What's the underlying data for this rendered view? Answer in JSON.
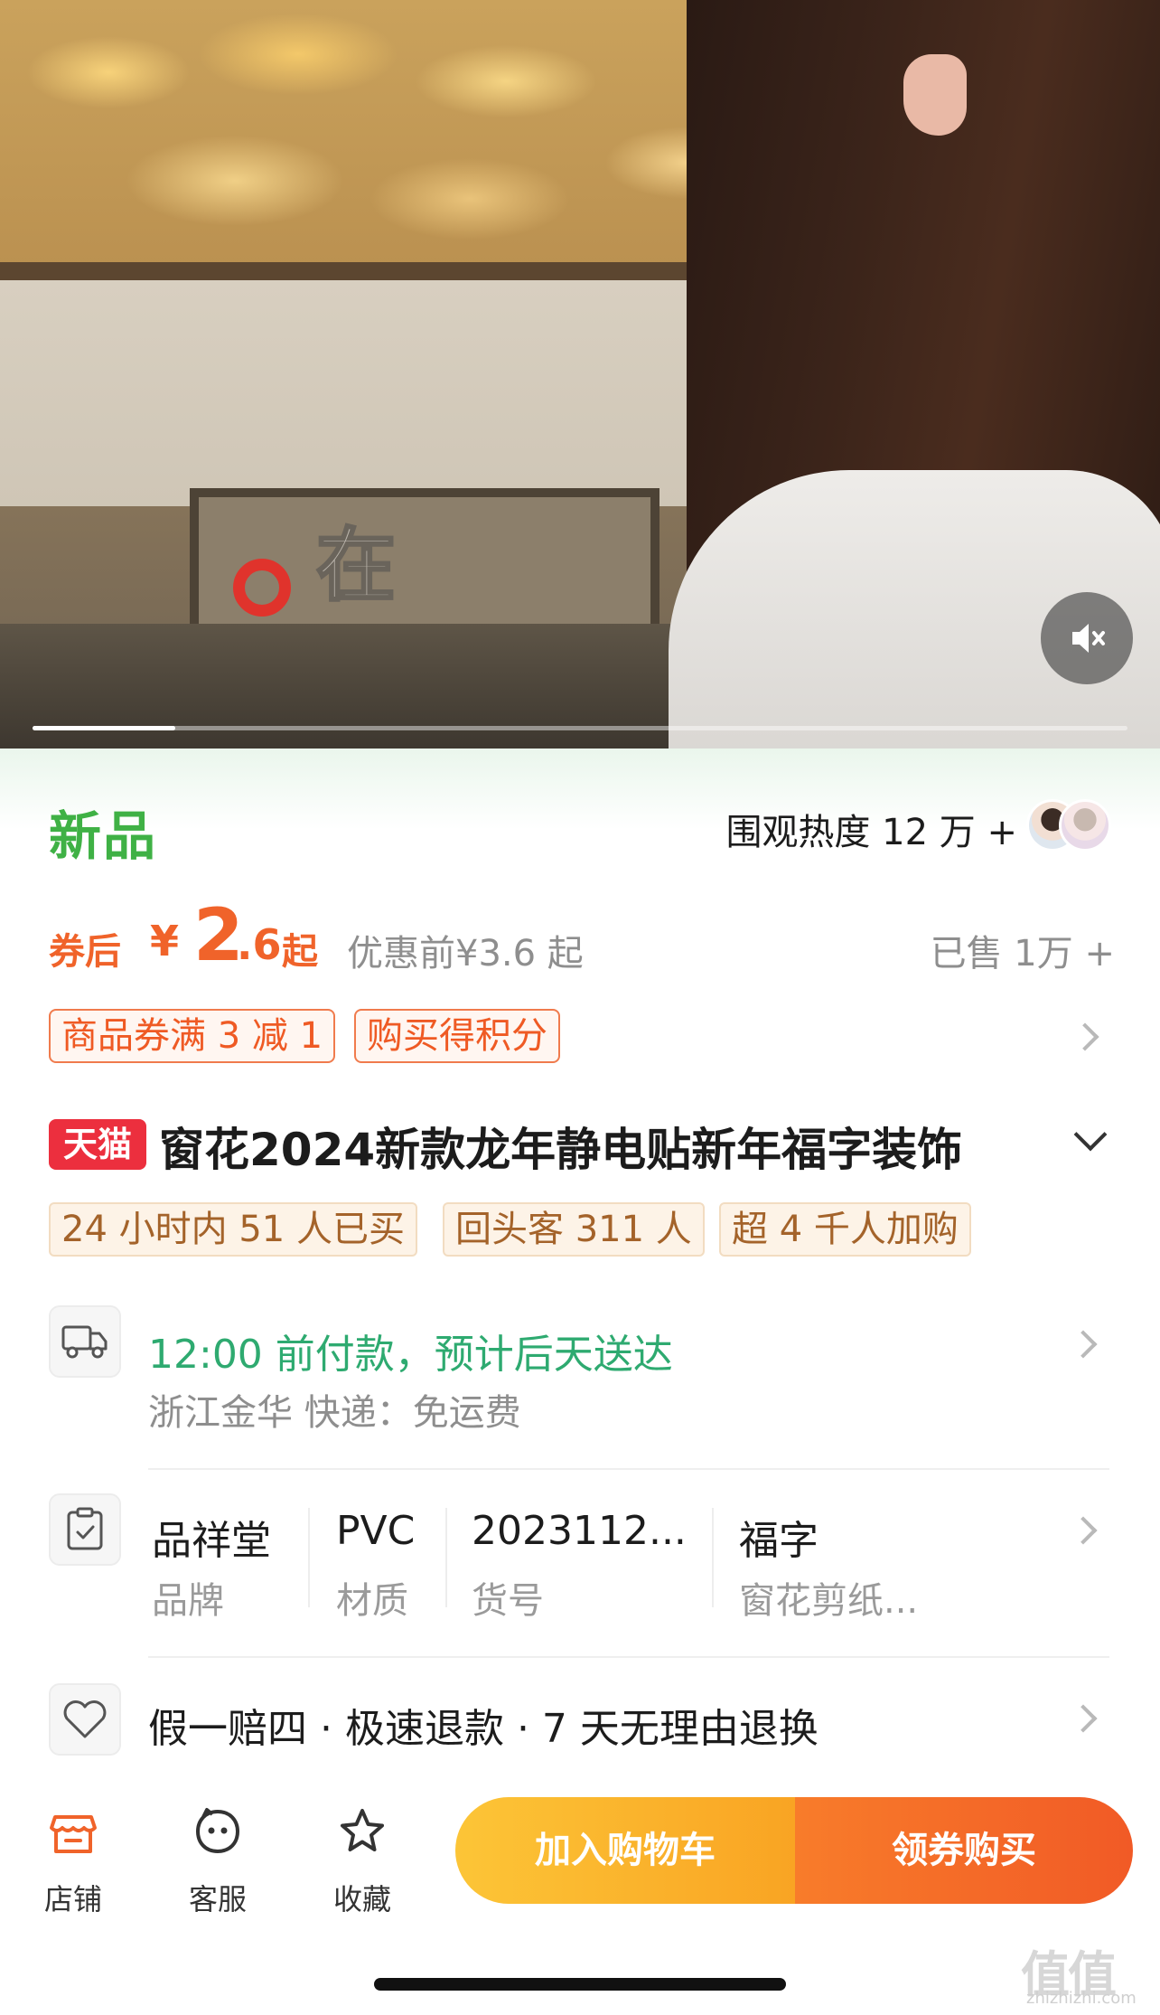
{
  "video": {
    "caption": "在",
    "progress_fraction": 0.13,
    "mute_icon": "speaker-muted-icon"
  },
  "header": {
    "new_label": "新品",
    "heat_text": "围观热度 12 万 +"
  },
  "price": {
    "prefix": "券后",
    "currency": "¥",
    "integer": "2",
    "decimal": ".6",
    "suffix": "起",
    "original": "优惠前¥3.6 起",
    "sold": "已售 1万 +"
  },
  "coupons": [
    "商品券满 3 减 1",
    "购买得积分"
  ],
  "title": {
    "badge": "天猫",
    "text": "窗花2024新款龙年静电贴新年福字装饰"
  },
  "tags": [
    "24 小时内 51 人已买",
    "回头客 311 人",
    "超 4 千人加购"
  ],
  "shipping": {
    "main": "12:00 前付款，预计后天送达",
    "sub": "浙江金华  快递：免运费",
    "icon": "truck-icon"
  },
  "attributes": [
    {
      "value": "品祥堂",
      "key": "品牌"
    },
    {
      "value": "PVC",
      "key": "材质"
    },
    {
      "value": "2023112...",
      "key": "货号"
    },
    {
      "value": "福字",
      "key": "窗花剪纸..."
    }
  ],
  "attributes_icon": "clipboard-check-icon",
  "guarantee": {
    "text": "假一赔四 · 极速退款 · 7 天无理由退换",
    "icon": "heart-shield-icon"
  },
  "bottom_bar": {
    "store": "店铺",
    "service": "客服",
    "favorite": "收藏",
    "add_to_cart": "加入购物车",
    "buy": "领券购买"
  },
  "watermark": {
    "main": "值值值",
    "sub": "zhizhizhi.com"
  },
  "colors": {
    "accent_orange": "#f0632a",
    "green": "#3fb145",
    "tmall_red": "#ec2f3e",
    "cart_yellow": "#fcc537",
    "buy_orange": "#f15a26"
  }
}
